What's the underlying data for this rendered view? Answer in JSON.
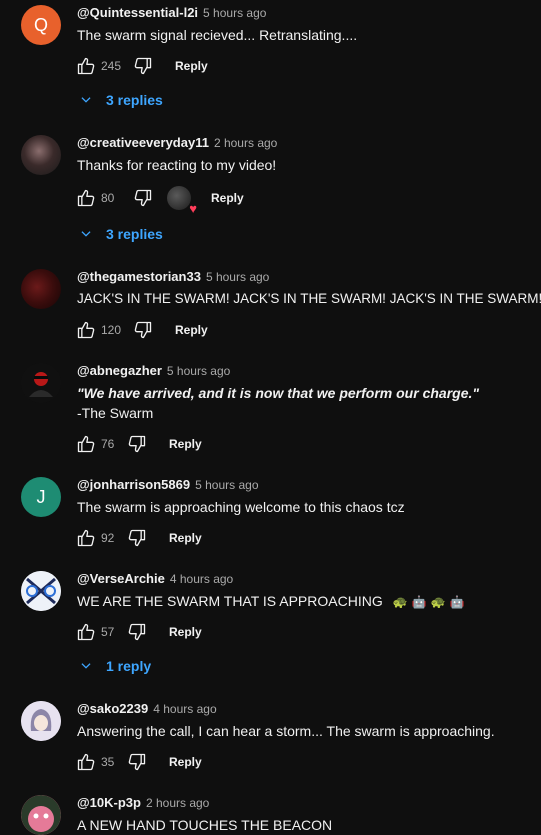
{
  "comments": [
    {
      "author": "@Quintessential-l2i",
      "time": "5 hours ago",
      "text": "The swarm signal recieved... Retranslating....",
      "likes": "245",
      "reply_label": "Reply",
      "replies_label": "3 replies",
      "avatar_letter": "Q",
      "avatar_color": "#e8612c"
    },
    {
      "author": "@creativeeveryday11",
      "time": "2 hours ago",
      "text": "Thanks for reacting to my video!",
      "likes": "80",
      "reply_label": "Reply",
      "replies_label": "3 replies"
    },
    {
      "author": "@thegamestorian33",
      "time": "5 hours ago",
      "text": "JACK'S IN THE SWARM! JACK'S IN THE SWARM! JACK'S IN THE SWARM!",
      "likes": "120",
      "reply_label": "Reply"
    },
    {
      "author": "@abnegazher",
      "time": "5 hours ago",
      "text_line1": "\"We have arrived, and it is now that we perform our charge.\"",
      "text_line2": "-The Swarm",
      "likes": "76",
      "reply_label": "Reply"
    },
    {
      "author": "@jonharrison5869",
      "time": "5 hours ago",
      "text": "The swarm is approaching welcome to this chaos tcz",
      "likes": "92",
      "reply_label": "Reply",
      "avatar_letter": "J",
      "avatar_color": "#1e8c73"
    },
    {
      "author": "@VerseArchie",
      "time": "4 hours ago",
      "text": "WE ARE THE SWARM THAT IS APPROACHING",
      "emojis": [
        "🐢",
        "🤖",
        "🐢",
        "🤖"
      ],
      "likes": "57",
      "reply_label": "Reply",
      "replies_label": "1 reply"
    },
    {
      "author": "@sako2239",
      "time": "4 hours ago",
      "text": "Answering the call, I can hear a storm... The swarm is approaching.",
      "likes": "35",
      "reply_label": "Reply"
    },
    {
      "author": "@10K-p3p",
      "time": "2 hours ago",
      "text": "A NEW HAND TOUCHES THE BEACON"
    }
  ],
  "colors": {
    "background": "#0f0f0f",
    "link": "#3ea6ff",
    "secondary_text": "#aaaaaa",
    "heart": "#ff3d5a"
  }
}
